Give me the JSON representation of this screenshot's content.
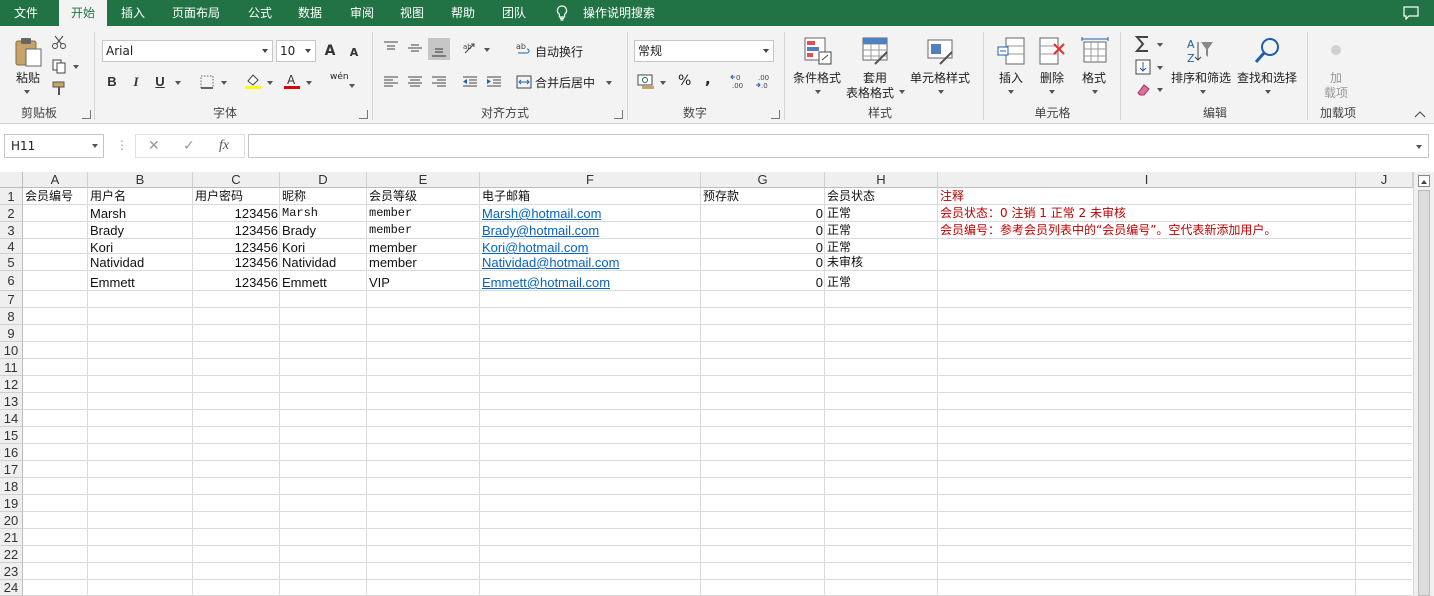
{
  "tabs": [
    "文件",
    "开始",
    "插入",
    "页面布局",
    "公式",
    "数据",
    "审阅",
    "视图",
    "帮助",
    "团队"
  ],
  "tell_me": "操作说明搜索",
  "ribbon": {
    "paste_label": "粘贴",
    "clipboard_group": "剪贴板",
    "font_name": "Arial",
    "font_size": "10",
    "font_group": "字体",
    "bold": "B",
    "italic": "I",
    "underline": "U",
    "grow_font": "A",
    "shrink_font": "A",
    "wrap_text": "自动换行",
    "merge_center": "合并后居中",
    "alignment_group": "对齐方式",
    "number_format": "常规",
    "percent": "%",
    "comma": ",",
    "number_group": "数字",
    "conditional_format": "条件格式",
    "table_format_1": "套用",
    "table_format_2": "表格格式",
    "cell_styles": "单元格样式",
    "styles_group": "样式",
    "insert": "插入",
    "delete": "删除",
    "format": "格式",
    "cells_group": "单元格",
    "sort_filter": "排序和筛选",
    "find_select": "查找和选择",
    "editing_group": "编辑",
    "addins_1": "加",
    "addins_2": "载项",
    "addins_group": "加载项",
    "phonetic": "wén"
  },
  "formula_bar": {
    "name_box": "H11",
    "cancel": "✕",
    "enter": "✓",
    "fx": "fx",
    "formula": ""
  },
  "columns": [
    "A",
    "B",
    "C",
    "D",
    "E",
    "F",
    "G",
    "H",
    "I",
    "J"
  ],
  "row_numbers": [
    "1",
    "2",
    "3",
    "4",
    "5",
    "6",
    "7",
    "8",
    "9",
    "10",
    "11",
    "12",
    "13",
    "14",
    "15",
    "16",
    "17",
    "18",
    "19",
    "20",
    "21",
    "22",
    "23",
    "24"
  ],
  "headers": [
    "会员编号",
    "用户名",
    "用户密码",
    "昵称",
    "会员等级",
    "电子邮箱",
    "预存款",
    "会员状态",
    "注释"
  ],
  "rows": [
    {
      "user": "Marsh",
      "pwd": "123456",
      "nick": "Marsh",
      "level": "member",
      "email": "Marsh@hotmail.com",
      "deposit": "0",
      "status": "正常",
      "note": "会员状态：0 注销 1 正常 2 未审核"
    },
    {
      "user": "Brady",
      "pwd": "123456",
      "nick": "Brady",
      "level": "member",
      "email": "Brady@hotmail.com",
      "deposit": "0",
      "status": "正常",
      "note": "会员编号：参考会员列表中的“会员编号”。空代表新添加用户。"
    },
    {
      "user": "Kori",
      "pwd": "123456",
      "nick": "Kori",
      "level": "member",
      "email": "Kori@hotmail.com",
      "deposit": "0",
      "status": "正常",
      "note": ""
    },
    {
      "user": "Natividad",
      "pwd": "123456",
      "nick": "Natividad",
      "level": "member",
      "email": "Natividad@hotmail.com",
      "deposit": "0",
      "status": "未审核",
      "note": ""
    },
    {
      "user": "Emmett",
      "pwd": "123456",
      "nick": "Emmett",
      "level": "VIP",
      "email": "Emmett@hotmail.com",
      "deposit": "0",
      "status": "正常",
      "note": ""
    }
  ],
  "colors": {
    "accent": "#217346",
    "link": "#0563c1",
    "note_red": "#c00000"
  }
}
